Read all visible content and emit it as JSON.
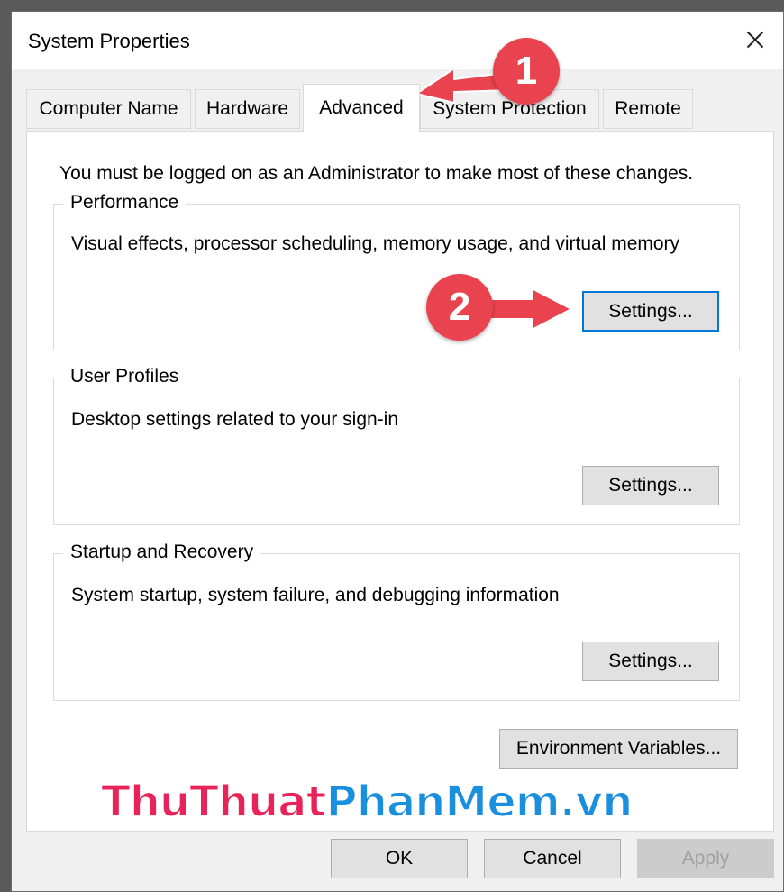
{
  "window": {
    "title": "System Properties"
  },
  "tabs": [
    {
      "label": "Computer Name"
    },
    {
      "label": "Hardware"
    },
    {
      "label": "Advanced"
    },
    {
      "label": "System Protection"
    },
    {
      "label": "Remote"
    }
  ],
  "active_tab": "Advanced",
  "notice": "You must be logged on as an Administrator to make most of these changes.",
  "groups": {
    "performance": {
      "title": "Performance",
      "description": "Visual effects, processor scheduling, memory usage, and virtual memory",
      "button": "Settings..."
    },
    "user_profiles": {
      "title": "User Profiles",
      "description": "Desktop settings related to your sign-in",
      "button": "Settings..."
    },
    "startup_recovery": {
      "title": "Startup and Recovery",
      "description": "System startup, system failure, and debugging information",
      "button": "Settings..."
    }
  },
  "env_button": "Environment Variables...",
  "footer": {
    "ok": "OK",
    "cancel": "Cancel",
    "apply": "Apply"
  },
  "watermark": {
    "part1": "ThuThuat",
    "part2": "PhanMem.vn"
  },
  "annotations": {
    "badge1": "1",
    "badge2": "2"
  },
  "colors": {
    "annotation": "#e8434f",
    "focus": "#0078d7",
    "wm_pink": "#e8235a",
    "wm_blue": "#1a8fde"
  }
}
